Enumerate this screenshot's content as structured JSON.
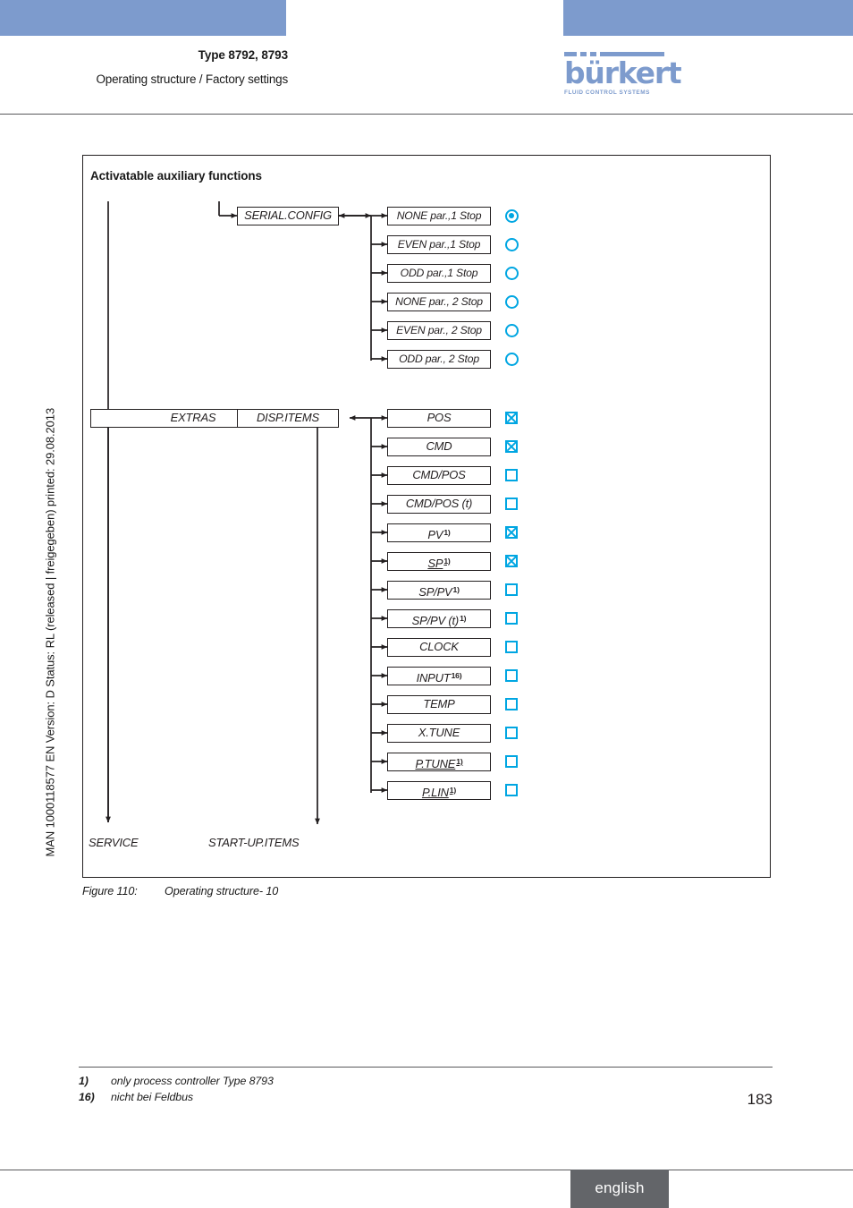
{
  "header": {
    "title": "Type 8792, 8793",
    "subtitle": "Operating structure / Factory settings",
    "logo_word": "bürkert",
    "logo_tagline": "FLUID CONTROL SYSTEMS"
  },
  "side_text": "MAN 1000118577  EN  Version: D  Status: RL (released | freigegeben)  printed: 29.08.2013",
  "diagram": {
    "title": "Activatable auxiliary functions",
    "serial_config": {
      "label": "SERIAL.CONFIG",
      "options": [
        {
          "label": "NONE par.,1 Stop",
          "selected": true
        },
        {
          "label": "EVEN par.,1 Stop",
          "selected": false
        },
        {
          "label": "ODD par.,1  Stop",
          "selected": false
        },
        {
          "label": "NONE par., 2 Stop",
          "selected": false
        },
        {
          "label": "EVEN par., 2 Stop",
          "selected": false
        },
        {
          "label": "ODD par., 2  Stop",
          "selected": false
        }
      ]
    },
    "extras": {
      "label": "EXTRAS"
    },
    "disp_items": {
      "label": "DISP.ITEMS",
      "options": [
        {
          "label": "POS",
          "sup": "",
          "underline": false,
          "checked": true
        },
        {
          "label": "CMD",
          "sup": "",
          "underline": false,
          "checked": true
        },
        {
          "label": "CMD/POS",
          "sup": "",
          "underline": false,
          "checked": false
        },
        {
          "label": "CMD/POS (t)",
          "sup": "",
          "underline": false,
          "checked": false
        },
        {
          "label": "PV",
          "sup": "1)",
          "underline": false,
          "checked": true
        },
        {
          "label": "SP",
          "sup": "1)",
          "underline": true,
          "checked": true
        },
        {
          "label": "SP/PV",
          "sup": "1)",
          "underline": false,
          "checked": false
        },
        {
          "label": "SP/PV (t)",
          "sup": "1)",
          "underline": false,
          "checked": false
        },
        {
          "label": "CLOCK",
          "sup": "",
          "underline": false,
          "checked": false
        },
        {
          "label": "INPUT",
          "sup": "16)",
          "underline": false,
          "checked": false
        },
        {
          "label": "TEMP",
          "sup": "",
          "underline": false,
          "checked": false
        },
        {
          "label": "X.TUNE",
          "sup": "",
          "underline": false,
          "checked": false
        },
        {
          "label": "P.TUNE",
          "sup": "1)",
          "underline": true,
          "checked": false
        },
        {
          "label": "P.LIN",
          "sup": "1)",
          "underline": true,
          "checked": false
        }
      ]
    },
    "terminals": {
      "service": "SERVICE",
      "startup_items": "START-UP.ITEMS"
    }
  },
  "figure": {
    "label": "Figure 110:",
    "caption": "Operating structure- 10"
  },
  "footnotes": [
    {
      "mark": "1)",
      "text": "only process controller Type 8793"
    },
    {
      "mark": "16)",
      "text": "nicht bei Feldbus"
    }
  ],
  "page_number": "183",
  "language_tab": "english",
  "colors": {
    "banner_blue": "#7d9bcd",
    "accent_cyan": "#00a6e2",
    "line_black": "#231f20",
    "tab_grey": "#636569"
  }
}
